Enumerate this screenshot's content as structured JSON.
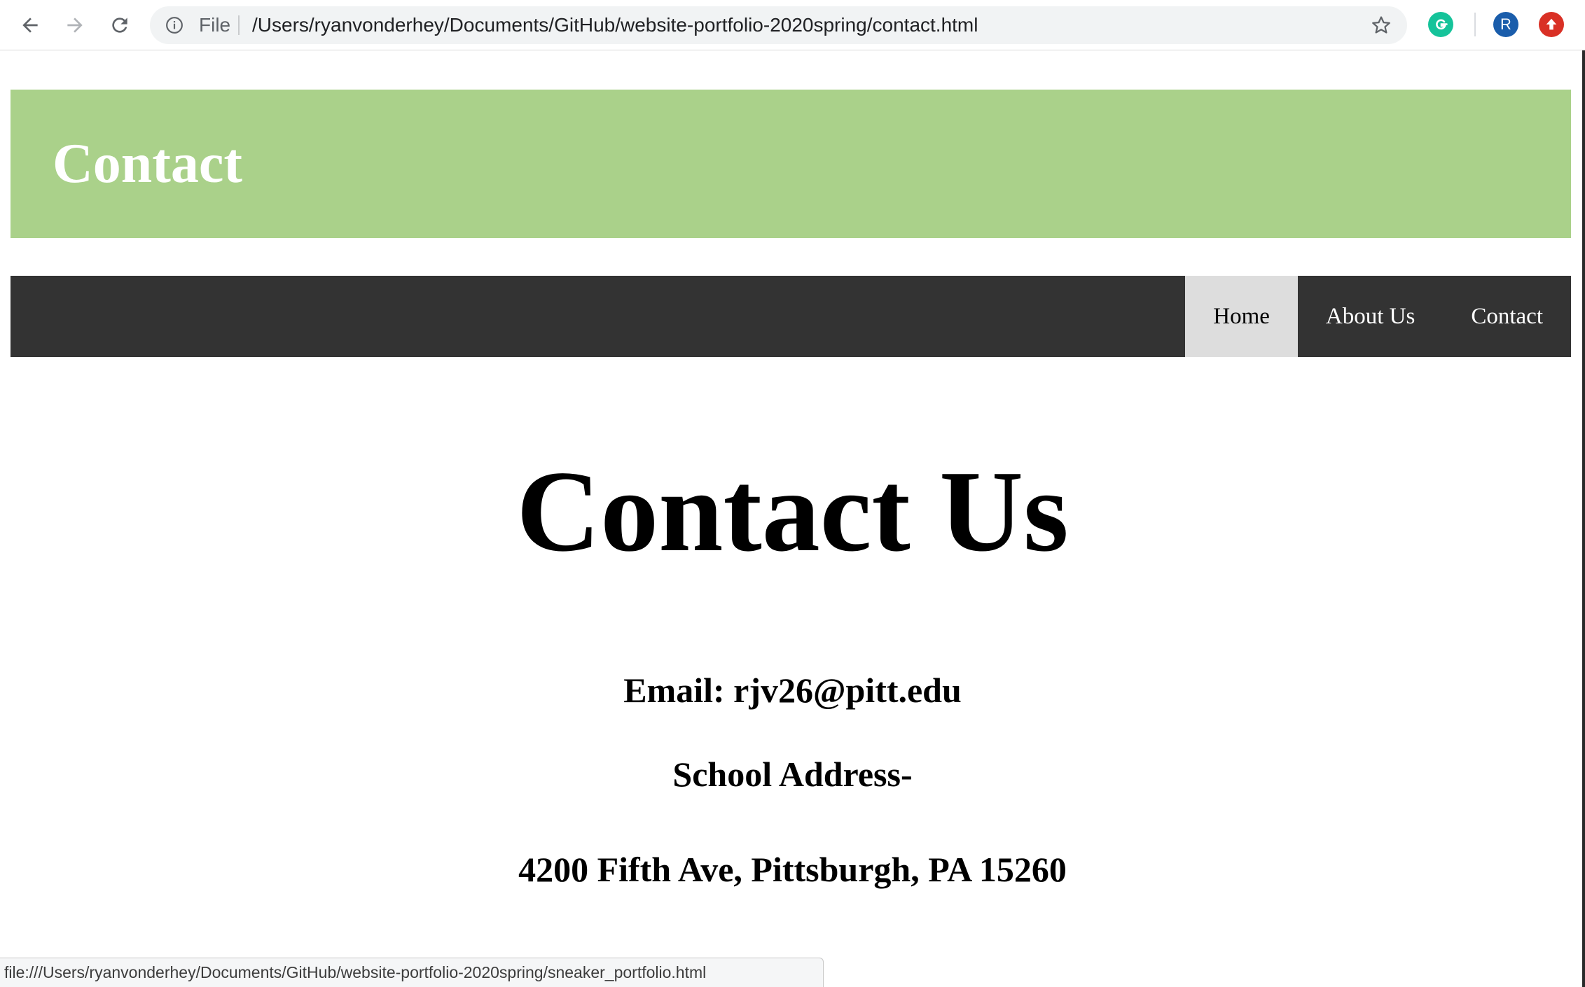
{
  "browser": {
    "scheme_label": "File",
    "url": "/Users/ryanvonderhey/Documents/GitHub/website-portfolio-2020spring/contact.html",
    "profile_initial": "R",
    "icons": [
      "back-arrow-icon",
      "forward-arrow-icon",
      "reload-icon",
      "info-icon",
      "bookmark-star-icon",
      "grammarly-extension-icon",
      "profile-avatar-icon",
      "update-extension-icon"
    ],
    "colors": {
      "grammarly": "#15c39a",
      "profile": "#1a5dab",
      "update": "#d93025"
    }
  },
  "site": {
    "header_title": "Contact",
    "nav": {
      "items": [
        {
          "label": "Home",
          "active": true
        },
        {
          "label": "About Us",
          "active": false
        },
        {
          "label": "Contact",
          "active": false
        }
      ]
    },
    "colors": {
      "header_bg": "#aad18a",
      "nav_bg": "#333333",
      "nav_active_bg": "#dddddd"
    }
  },
  "main": {
    "heading": "Contact Us",
    "email_line": "Email: rjv26@pitt.edu",
    "address_label": "School Address-",
    "address": "4200 Fifth Ave, Pittsburgh, PA 15260"
  },
  "status_bar": {
    "link_url": "file:///Users/ryanvonderhey/Documents/GitHub/website-portfolio-2020spring/sneaker_portfolio.html"
  }
}
